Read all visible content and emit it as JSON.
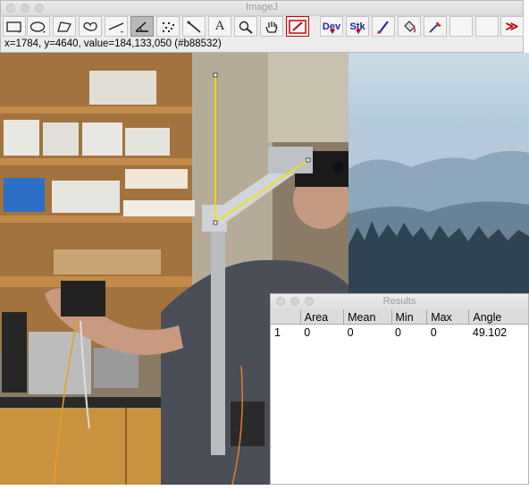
{
  "window": {
    "title": "ImageJ"
  },
  "toolbar": {
    "tools": [
      {
        "icon": "rectangle-tool-icon"
      },
      {
        "icon": "oval-tool-icon"
      },
      {
        "icon": "polygon-tool-icon"
      },
      {
        "icon": "freehand-tool-icon"
      },
      {
        "icon": "line-tool-icon"
      },
      {
        "icon": "angle-tool-icon"
      },
      {
        "icon": "point-tool-icon"
      },
      {
        "icon": "wand-tool-icon"
      },
      {
        "icon": "text-tool-icon"
      },
      {
        "icon": "magnifier-tool-icon"
      },
      {
        "icon": "hand-tool-icon"
      },
      {
        "icon": "color-picker-tool-icon"
      }
    ],
    "active_tool": "angle-tool-icon",
    "dev_label": "Dev",
    "stk_label": "Stk",
    "more_label": "≫",
    "text_tool_glyph": "A"
  },
  "status": {
    "text": "x=1784, y=4640, value=184,133,050 (#b88532)"
  },
  "results": {
    "title": "Results",
    "columns": [
      "",
      "Area",
      "Mean",
      "Min",
      "Max",
      "Angle"
    ],
    "rows": [
      [
        "1",
        "0",
        "0",
        "0",
        "0",
        "49.102"
      ]
    ]
  },
  "colors": {
    "measurement_line": "#f2e200",
    "pixel_value": "#b88532"
  }
}
